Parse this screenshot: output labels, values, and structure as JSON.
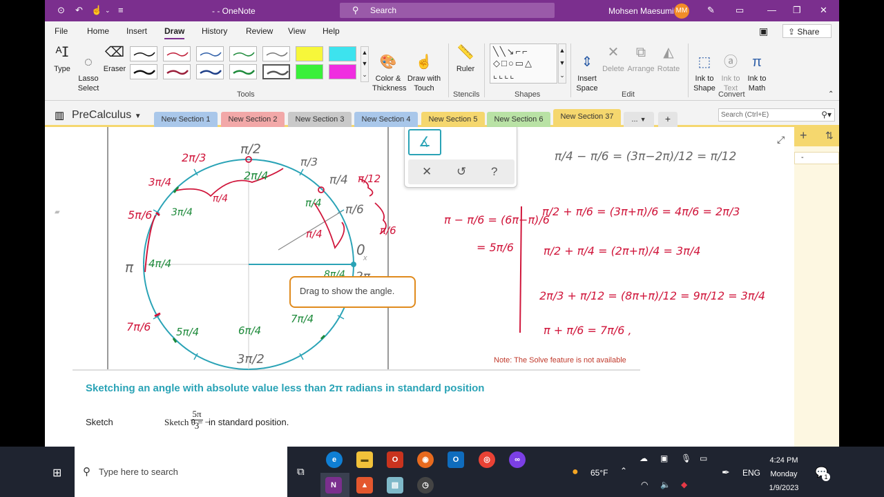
{
  "titlebar": {
    "doc_title": "- - OneNote",
    "search": "Search",
    "user": "Mohsen Maesumi",
    "initials": "MM"
  },
  "menu": {
    "tabs": [
      "File",
      "Home",
      "Insert",
      "Draw",
      "History",
      "Review",
      "View",
      "Help"
    ],
    "active": "Draw",
    "share": "Share"
  },
  "ribbon": {
    "type": "Type",
    "lasso": "Lasso\nSelect",
    "eraser": "Eraser",
    "color": "Color &\nThickness",
    "draw_touch": "Draw with\nTouch",
    "ruler": "Ruler",
    "insert_space": "Insert\nSpace",
    "delete": "Delete",
    "arrange": "Arrange",
    "rotate": "Rotate",
    "ink_shape": "Ink to\nShape",
    "ink_text": "Ink to\nText",
    "ink_math": "Ink to\nMath",
    "groups": {
      "tools": "Tools",
      "stencils": "Stencils",
      "shapes": "Shapes",
      "edit": "Edit",
      "convert": "Convert"
    }
  },
  "notebook": {
    "name": "PreCalculus",
    "sections": [
      {
        "label": "New Section 1",
        "color": "#a9c7ea"
      },
      {
        "label": "New Section 2",
        "color": "#f2a8a8"
      },
      {
        "label": "New Section 3",
        "color": "#c9c9c9"
      },
      {
        "label": "New Section 4",
        "color": "#a9c7ea"
      },
      {
        "label": "New Section 5",
        "color": "#f5d76e"
      },
      {
        "label": "New Section 6",
        "color": "#b9e2a5"
      },
      {
        "label": "New Section 37",
        "color": "#f5d76e"
      }
    ],
    "more": "...",
    "search_placeholder": "Search (Ctrl+E)"
  },
  "canvas": {
    "drag_tip": "Drag to show the angle.",
    "note": "Note: The Solve feature is not available",
    "heading": "Sketching an angle with absolute value less than 2π radians in standard position",
    "sketch_prefix": "Sketch θ = −",
    "frac_num": "5π",
    "frac_den": "3",
    "sketch_suffix": "in standard position.",
    "axis_x": "x",
    "page_dash": "-"
  },
  "taskbar": {
    "search_placeholder": "Type here to search",
    "weather": "65°F",
    "lang": "ENG",
    "time": "4:24 PM",
    "day": "Monday",
    "date": "1/9/2023",
    "notif_count": "1"
  },
  "colors": {
    "accent": "#7b2f8e",
    "teal": "#2aa3b6",
    "ink_red": "#d0163b",
    "ink_green": "#1d8a3a"
  }
}
